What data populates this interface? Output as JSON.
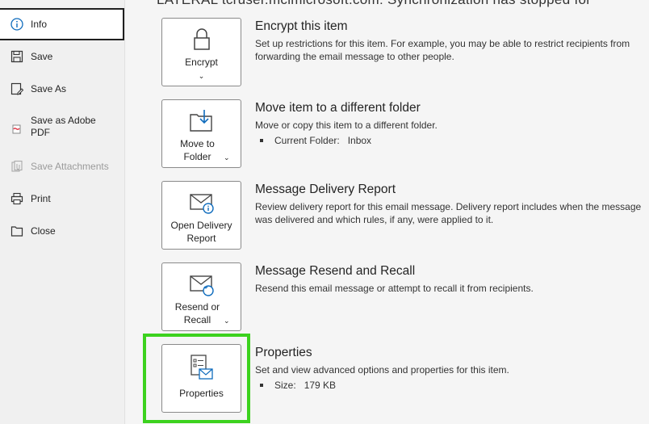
{
  "banner": "LATERAL tcruser.mclmicrosoft.com: Synchronization has stopped for",
  "sidebar": {
    "items": [
      {
        "label": "Info",
        "icon": "info-icon"
      },
      {
        "label": "Save",
        "icon": "save-icon"
      },
      {
        "label": "Save As",
        "icon": "save-as-icon"
      },
      {
        "label": "Save as Adobe PDF",
        "icon": "adobe-pdf-icon"
      },
      {
        "label": "Save Attachments",
        "icon": "attachment-icon"
      },
      {
        "label": "Print",
        "icon": "printer-icon"
      },
      {
        "label": "Close",
        "icon": "folder-icon"
      }
    ]
  },
  "sections": {
    "encrypt": {
      "tile_label": "Encrypt",
      "title": "Encrypt this item",
      "desc": "Set up restrictions for this item. For example, you may be able to restrict recipients from forwarding the email message to other people."
    },
    "move": {
      "tile_label": "Move to Folder",
      "title": "Move item to a different folder",
      "desc": "Move or copy this item to a different folder.",
      "bullet_key": "Current Folder:",
      "bullet_value": "Inbox"
    },
    "delivery": {
      "tile_label": "Open Delivery Report",
      "title": "Message Delivery Report",
      "desc": "Review delivery report for this email message. Delivery report includes when the message was delivered and which rules, if any, were applied to it."
    },
    "resend": {
      "tile_label": "Resend or Recall",
      "title": "Message Resend and Recall",
      "desc": "Resend this email message or attempt to recall it from recipients."
    },
    "properties": {
      "tile_label": "Properties",
      "title": "Properties",
      "desc": "Set and view advanced options and properties for this item.",
      "bullet_key": "Size:",
      "bullet_value": "179 KB"
    }
  },
  "colors": {
    "highlight": "#3cd21e",
    "accent": "#0f6cbd"
  }
}
